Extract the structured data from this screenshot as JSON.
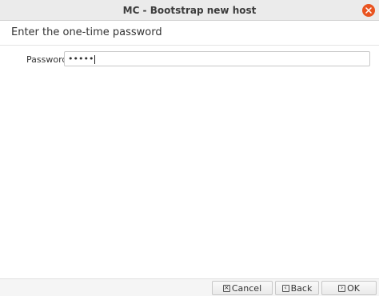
{
  "window": {
    "title": "MC - Bootstrap new host"
  },
  "header": {
    "title": "Enter the one-time password"
  },
  "form": {
    "password_label": "Password",
    "password_value": "•••••"
  },
  "buttons": {
    "cancel": "Cancel",
    "back": "Back",
    "ok": "OK"
  },
  "icons": {
    "close": "close-icon",
    "cancel": "x-box-icon",
    "back": "chevron-left-box-icon",
    "ok": "chevron-right-box-icon"
  },
  "colors": {
    "close_button": "#e95420",
    "titlebar": "#ebebeb"
  }
}
